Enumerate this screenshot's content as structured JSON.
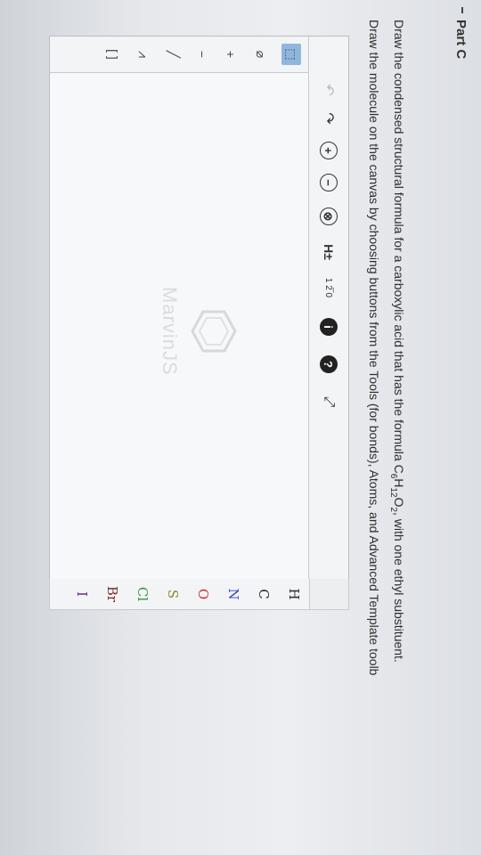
{
  "part": {
    "title": "Part C"
  },
  "instructions": {
    "line1_prefix": "Draw the condensed structural formula for a carboxylic acid that has the formula C",
    "f_c": "6",
    "f_h_letter": "H",
    "f_h": "12",
    "f_o_letter": "O",
    "f_o": "2",
    "line1_suffix": ", with one ethyl substituent.",
    "line2": "Draw the molecule on the canvas by choosing buttons from the Tools (for bonds), Atoms, and Advanced Template toolb"
  },
  "toolbar": {
    "undo_icon": "undo-icon",
    "redo_icon": "redo-icon",
    "zoom_in": "+",
    "zoom_out": "−",
    "clear": "⊗",
    "h_toggle": "H±",
    "numbering": "1 2̅ 0",
    "info": "i",
    "help": "?",
    "fullscreen_icon": "expand-icon"
  },
  "left_tools": {
    "selection": "selection-icon",
    "erase": "eraser-icon",
    "charge_plus": "+",
    "charge_minus": "−",
    "single_bond": "single-bond-icon",
    "chain": "chain-icon",
    "bracket": "bracket-icon"
  },
  "atoms": [
    {
      "symbol": "H",
      "color": "#2b2b2b"
    },
    {
      "symbol": "C",
      "color": "#2b2b2b"
    },
    {
      "symbol": "N",
      "color": "#2d46c8"
    },
    {
      "symbol": "O",
      "color": "#d43030"
    },
    {
      "symbol": "S",
      "color": "#8a8a2a"
    },
    {
      "symbol": "Cl",
      "color": "#2e9a3a"
    },
    {
      "symbol": "Br",
      "color": "#7a2a2a"
    },
    {
      "symbol": "I",
      "color": "#6a2a8a"
    }
  ],
  "watermark": {
    "text": "MarvinJS"
  }
}
